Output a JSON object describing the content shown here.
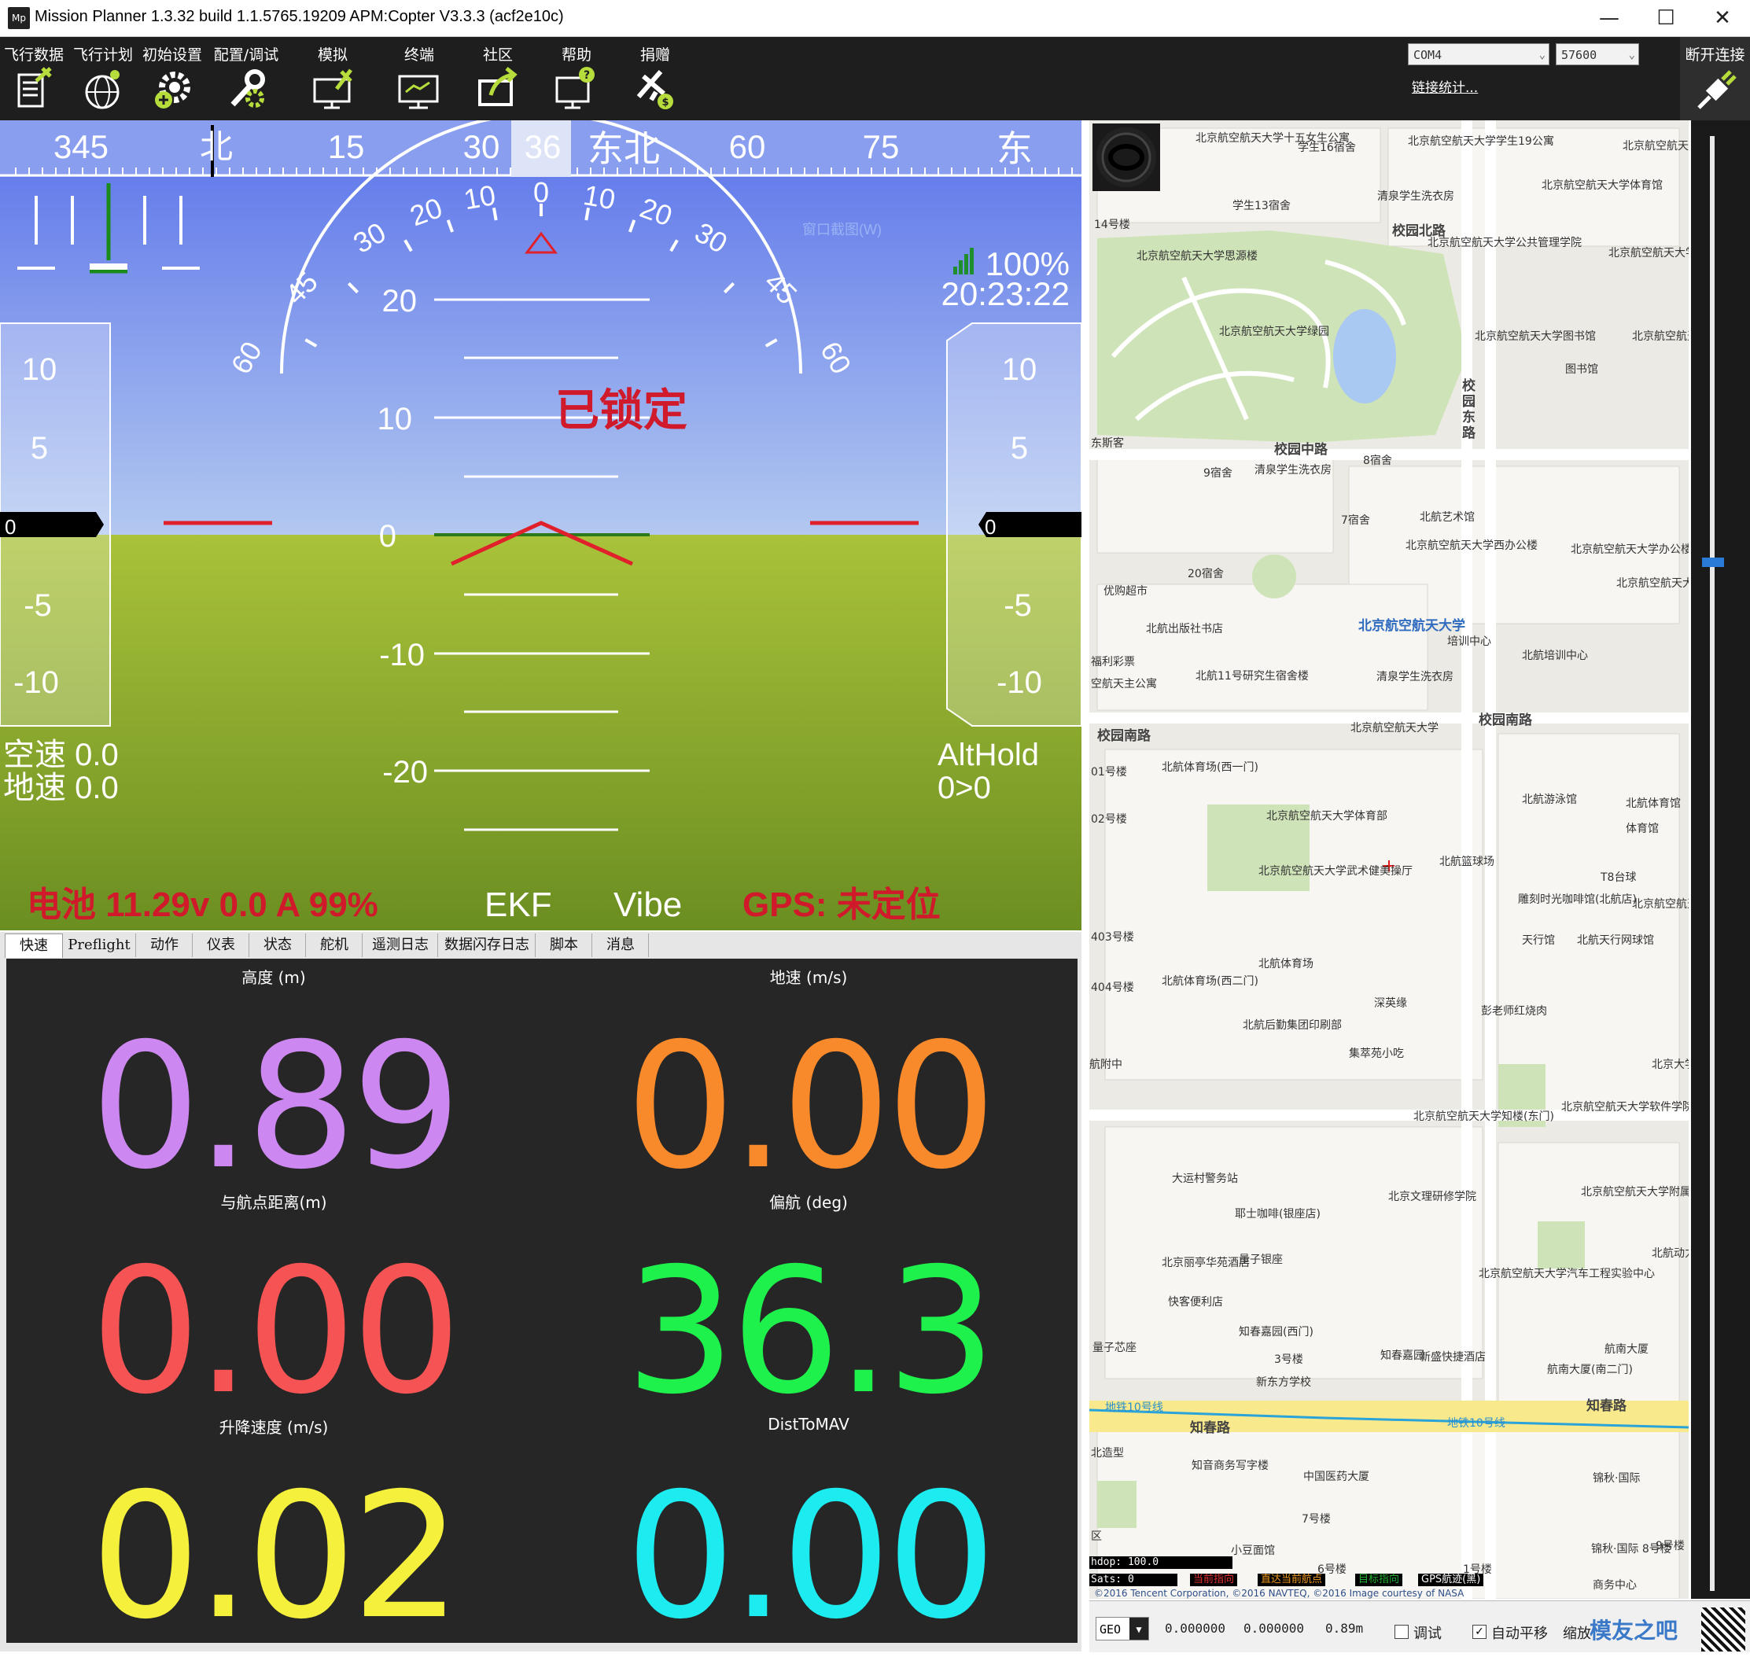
{
  "window": {
    "title": "Mission Planner 1.3.32 build 1.1.5765.19209 APM:Copter V3.3.3 (acf2e10c)",
    "app_icon": "Mp",
    "minimize": "—",
    "maximize": "☐",
    "close": "✕"
  },
  "toolbar": {
    "items": [
      {
        "label": "飞行数据",
        "icon": "flight-data-icon"
      },
      {
        "label": "飞行计划",
        "icon": "flight-plan-icon"
      },
      {
        "label": "初始设置",
        "icon": "initial-setup-icon"
      },
      {
        "label": "配置/调试",
        "icon": "config-tuning-icon"
      },
      {
        "label": "模拟",
        "icon": "simulation-icon"
      },
      {
        "label": "终端",
        "icon": "terminal-icon"
      },
      {
        "label": "社区",
        "icon": "community-icon"
      },
      {
        "label": "帮助",
        "icon": "help-icon"
      },
      {
        "label": "捐赠",
        "icon": "donate-icon"
      }
    ],
    "port": "COM4",
    "baud": "57600",
    "link_stats": "链接统计...",
    "disconnect": "断开连接"
  },
  "hud": {
    "heading_tape": [
      "345",
      "北",
      "15",
      "30",
      "36",
      "东北",
      "60",
      "75",
      "东"
    ],
    "heading_value": "36",
    "roll_scale": [
      "60",
      "45",
      "30",
      "20",
      "10",
      "0",
      "10",
      "20",
      "30",
      "45",
      "60"
    ],
    "pitch_scale": [
      "20",
      "10",
      "0",
      "-10",
      "-20"
    ],
    "left_tape": [
      "10",
      "5",
      "0",
      "-5",
      "-10"
    ],
    "right_tape": [
      "10",
      "5",
      "0",
      "-5",
      "-10"
    ],
    "left_value": "0",
    "right_value": "0",
    "armed_status": "已锁定",
    "signal": "100%",
    "time": "20:23:22",
    "airspeed": "空速 0.0",
    "groundspeed": "地速 0.0",
    "mode": "AltHold",
    "wp": "0>0",
    "battery": "电池 11.29v 0.0 A 99%",
    "ekf": "EKF",
    "vibe": "Vibe",
    "gps": "GPS: 未定位",
    "faint_overlay": "窗口截图(W)",
    "colors": {
      "sky": "#7f95ee",
      "ground": "#9ab33a",
      "warn": "#d0192b"
    }
  },
  "tabs": [
    "快速",
    "Preflight",
    "动作",
    "仪表",
    "状态",
    "舵机",
    "遥测日志",
    "数据闪存日志",
    "脚本",
    "消息"
  ],
  "quick": [
    {
      "label": "高度 (m)",
      "value": "0.89",
      "color": "#cc88f0"
    },
    {
      "label": "地速 (m/s)",
      "value": "0.00",
      "color": "#f98a2c"
    },
    {
      "label": "与航点距离(m)",
      "value": "0.00",
      "color": "#f65454"
    },
    {
      "label": "偏航 (deg)",
      "value": "36.3",
      "color": "#1ef04c"
    },
    {
      "label": "升降速度 (m/s)",
      "value": "0.02",
      "color": "#f4f03c"
    },
    {
      "label": "DistToMAV",
      "value": "0.00",
      "color": "#1cecf0"
    }
  ],
  "map": {
    "labels": [
      "北京航空航天大学十五女生公寓",
      "学生16宿舍",
      "北京航空航天大学学生19公寓",
      "北京航空航天大学教育培训中心",
      "学生13宿舍",
      "清泉学生洗衣房",
      "北京航空航天大学体育馆",
      "14号楼",
      "校园北路",
      "北京航空航天大学思源楼",
      "北京航空航天大学公共管理学院",
      "北京航空航天大学学术交流",
      "北京航空航天大学绿园",
      "北京航空航天大学图书馆",
      "北京航空航天大学国际",
      "图书馆",
      "校园东路",
      "校园中路",
      "东斯客",
      "9宿舍",
      "清泉学生洗衣房",
      "8宿舍",
      "7宿舍",
      "北航艺术馆",
      "北京航空航天大学西办公楼",
      "北京航空航天大学办公楼",
      "20宿舍",
      "优购超市",
      "北京航空航天大学校务工作办公室",
      "北航出版社书店",
      "北京航空航天大学",
      "培训中心",
      "北航培训中心",
      "福利彩票",
      "北航11号研究生宿舍楼",
      "清泉学生洗衣房",
      "空航天主公寓",
      "校园南路",
      "校园南路",
      "北京航空航天大学",
      "01号楼",
      "北航体育场(西一门)",
      "北航游泳馆",
      "北航体育馆",
      "体育馆",
      "北京航空航天大学体育部",
      "02号楼",
      "北京航空航天大学武术健美操厅",
      "北航篮球场",
      "T8台球",
      "雕刻时光咖啡馆(北航店)",
      "北京航空航天大学飞",
      "天行馆",
      "北航天行网球馆",
      "403号楼",
      "北航体育场",
      "404号楼",
      "北航体育场(西二门)",
      "深英缘",
      "彭老师红烧肉",
      "北航后勤集团印刷部",
      "集萃苑小吃",
      "航附中",
      "北京大学",
      "北京航空航天大学软件学院",
      "北京航空航天大学知楼(东门)",
      "大运村警务站",
      "北京文理研修学院",
      "北京航空航天大学附属小学",
      "耶士咖啡(银座店)",
      "北京丽亭华苑酒店",
      "量子银座",
      "北京航空航天大学汽车工程实验中心",
      "快客便利店",
      "北航动力",
      "知春嘉园(西门)",
      "量子芯座",
      "3号楼",
      "知春嘉园",
      "新盛快捷酒店",
      "航南大厦",
      "航南大厦(南二门)",
      "新东方学校",
      "地铁10号线",
      "地铁10号线",
      "知春路",
      "知春路",
      "北造型",
      "知音商务写字楼",
      "中国医药大厦",
      "锦秋·国际",
      "7号楼",
      "小豆面馆",
      "锦秋·国际 8号楼",
      "9号楼",
      "6号楼",
      "1号楼",
      "商务中心",
      "区"
    ],
    "hdop": "hdop: 100.0",
    "sats": "Sats: 0",
    "legend": [
      "当前指向",
      "直达当前航点",
      "目标指向",
      "GPS航迹(黑)"
    ],
    "copyright": "©2016 Tencent Corporation, ©2016 NAVTEQ, ©2016 Image courtesy of NASA",
    "bottom": {
      "coord_type": "GEO",
      "lat": "0.000000",
      "lng": "0.000000",
      "alt": "0.89m",
      "debug": "调试",
      "autopan": "自动平移",
      "zoom": "缩放",
      "watermark": "模友之吧"
    }
  }
}
